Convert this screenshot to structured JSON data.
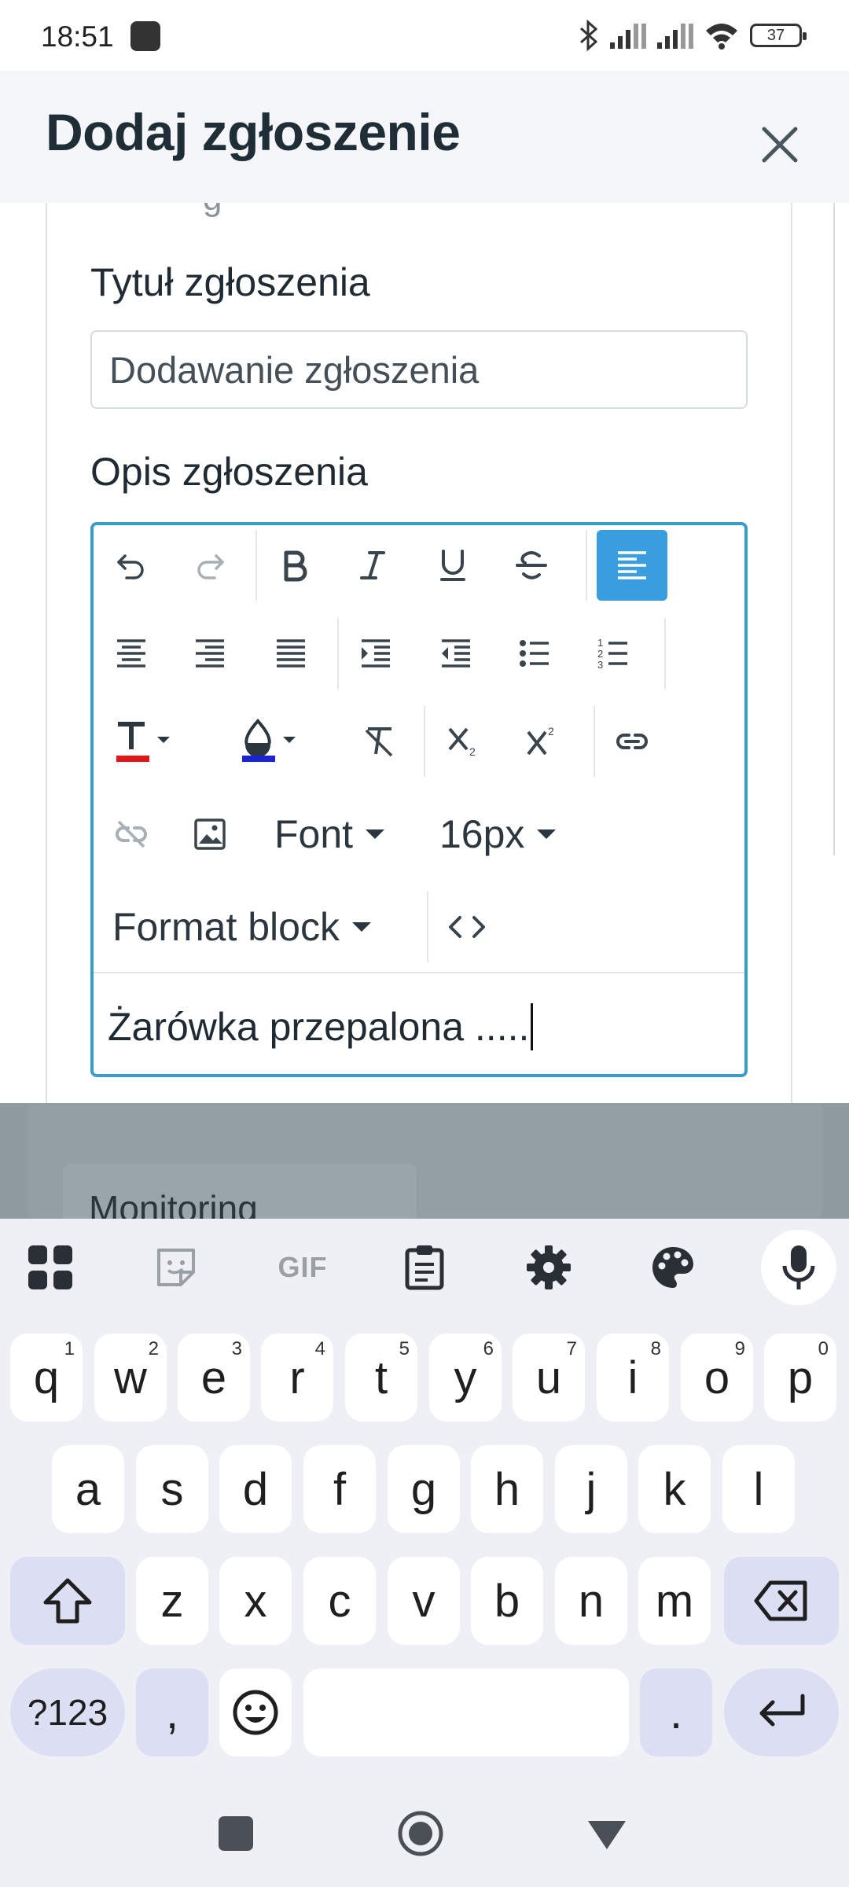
{
  "status_bar": {
    "time": "18:51",
    "battery": "37"
  },
  "modal": {
    "title": "Dodaj zgłoszenie",
    "title_label": "Tytuł zgłoszenia",
    "title_value": "Dodawanie zgłoszenia",
    "description_label": "Opis zgłoszenia",
    "cut_label_fragment": "g"
  },
  "editor": {
    "font_label": "Font",
    "size_label": "16px",
    "format_label": "Format block",
    "content": "Żarówka przepalona ....."
  },
  "background": {
    "section_label": "Monitoring"
  },
  "keyboard": {
    "gif_label": "GIF",
    "row1": [
      {
        "key": "q",
        "hint": "1"
      },
      {
        "key": "w",
        "hint": "2"
      },
      {
        "key": "e",
        "hint": "3"
      },
      {
        "key": "r",
        "hint": "4"
      },
      {
        "key": "t",
        "hint": "5"
      },
      {
        "key": "y",
        "hint": "6"
      },
      {
        "key": "u",
        "hint": "7"
      },
      {
        "key": "i",
        "hint": "8"
      },
      {
        "key": "o",
        "hint": "9"
      },
      {
        "key": "p",
        "hint": "0"
      }
    ],
    "row2": [
      "a",
      "s",
      "d",
      "f",
      "g",
      "h",
      "j",
      "k",
      "l"
    ],
    "row3": [
      "z",
      "x",
      "c",
      "v",
      "b",
      "n",
      "m"
    ],
    "symbols_label": "?123",
    "comma": ",",
    "period": "."
  },
  "colors": {
    "accent": "#3a9cc8",
    "active_button": "#3a9ede",
    "text_color_bar": "#e0161b",
    "highlight_bar": "#1a23d8"
  },
  "icons": {
    "toolbar": [
      "undo-icon",
      "redo-icon",
      "bold-icon",
      "italic-icon",
      "underline-icon",
      "strikethrough-icon",
      "align-left-icon",
      "align-center-icon",
      "align-right-icon",
      "align-justify-icon",
      "indent-icon",
      "outdent-icon",
      "bullet-list-icon",
      "numbered-list-icon",
      "text-color-icon",
      "highlight-color-icon",
      "clear-format-icon",
      "subscript-icon",
      "superscript-icon",
      "link-icon",
      "unlink-icon",
      "image-icon",
      "code-view-icon"
    ]
  }
}
